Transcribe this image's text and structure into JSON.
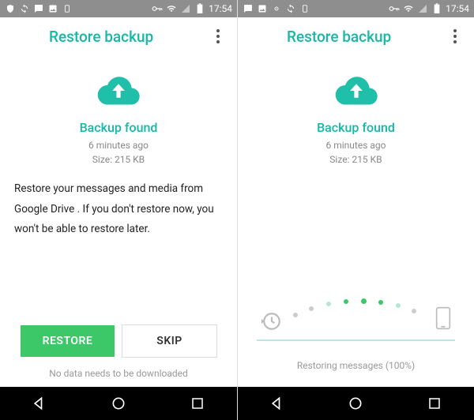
{
  "statusbar": {
    "time": "17:54"
  },
  "appbar": {
    "title": "Restore backup"
  },
  "backup": {
    "found_label": "Backup found",
    "time_ago": "6 minutes ago",
    "size": "Size: 215 KB"
  },
  "left": {
    "description": "Restore your messages and media from Google Drive . If you don't restore now, you won't be able to restore later.",
    "restore_btn": "RESTORE",
    "skip_btn": "SKIP",
    "footer": "No data needs to be downloaded"
  },
  "right": {
    "status": "Restoring messages (100%)"
  }
}
